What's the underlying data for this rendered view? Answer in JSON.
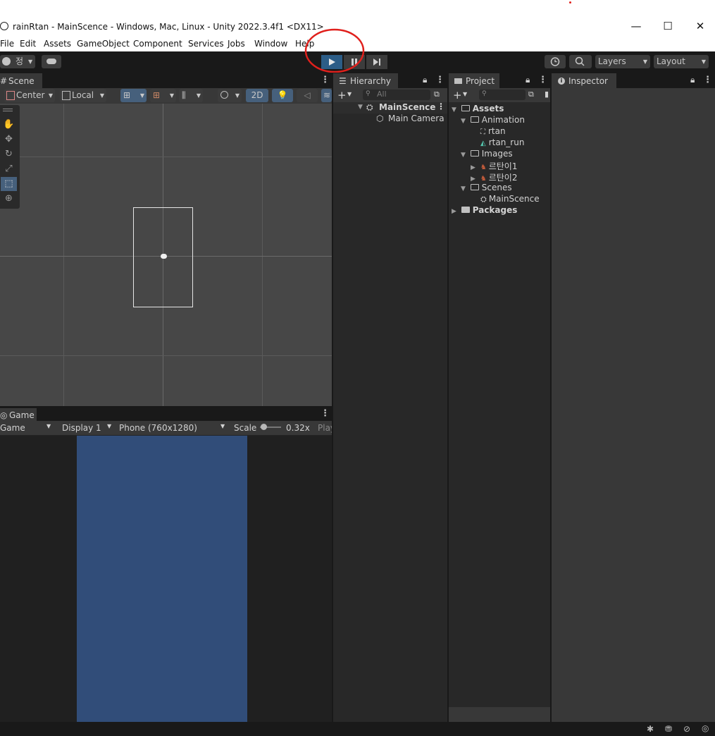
{
  "window": {
    "title": "rainRtan - MainScence - Windows, Mac, Linux - Unity 2022.3.4f1 <DX11>",
    "minimize": "—",
    "maximize": "☐",
    "close": "✕"
  },
  "menu": [
    "File",
    "Edit",
    "Assets",
    "GameObject",
    "Component",
    "Services",
    "Jobs",
    "Window",
    "Help"
  ],
  "toolbar": {
    "account_label": "정",
    "layers_label": "Layers",
    "layout_label": "Layout",
    "play_icon": "play-icon",
    "accent_color": "#2c5d87"
  },
  "scene": {
    "tab_label": "Scene",
    "pivot_label": "Center",
    "space_label": "Local",
    "mode_2d": "2D"
  },
  "game": {
    "tab_label": "Game",
    "game_dropdown": "Game",
    "display": "Display 1",
    "resolution": "Phone (760x1280)",
    "scale_label": "Scale",
    "scale_value": "0.32x",
    "play_focused_label": "Play",
    "camera_bg_color": "#314d79"
  },
  "hierarchy": {
    "tab_label": "Hierarchy",
    "search_placeholder": "All",
    "scene_name": "MainScence",
    "items": [
      "Main Camera"
    ]
  },
  "project": {
    "tab_label": "Project",
    "assets_label": "Assets",
    "animation_label": "Animation",
    "anim_items": [
      "rtan",
      "rtan_run"
    ],
    "images_label": "Images",
    "image_items": [
      "르탄이1",
      "르탄이2"
    ],
    "scenes_label": "Scenes",
    "scene_items": [
      "MainScence"
    ],
    "packages_label": "Packages"
  },
  "inspector": {
    "tab_label": "Inspector"
  }
}
